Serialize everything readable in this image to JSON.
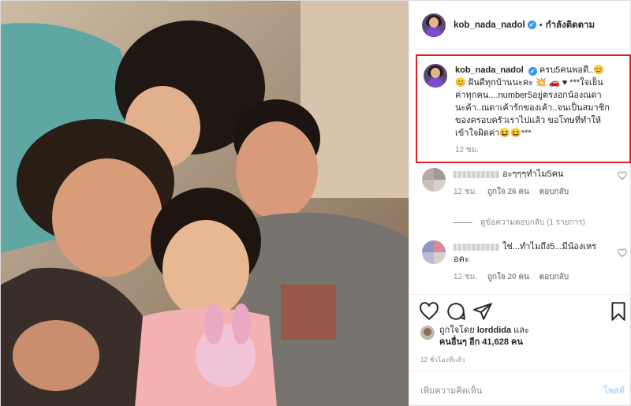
{
  "post": {
    "username": "kob_nada_nadol",
    "verified_mark": "✔",
    "separator": "•",
    "follow_status": "กำลังติดตาม"
  },
  "caption": {
    "username": "kob_nada_nadol",
    "line1": "ครบ5คนพอดี..😊",
    "line2": "😊 ฝันดีทุกบ้านนะคะ 💥 🚗 ♥ ***ใจเย็น",
    "line3": "ค่าทุกคน....number5อยู่ตรงอกน้องณดา",
    "line4": "นะค้า..ณดาเค้ารักของเค้า..จนเป็นสมาชิก",
    "line5": "ของครอบครัวเราไปแล้ว ขอโทษที่ทำให้",
    "line6": "เข้าใจผิดค่า😆😆***",
    "time": "12 ชม.",
    "highlight_color": "#e11f25"
  },
  "comments": [
    {
      "text": "อะๆๆๆทำไม5คน",
      "time": "12 ชม.",
      "likes": "ถูกใจ 26 คน",
      "reply": "ตอบกลับ"
    },
    {
      "text_line1": "ใช่...ทำไมถึง5...มีน้องเหร",
      "text_line2": "อคะ",
      "time": "12 ชม.",
      "likes": "ถูกใจ 20 คน",
      "reply": "ตอบกลับ"
    }
  ],
  "view_replies": "ดูข้อความตอบกลับ (1 รายการ)",
  "liked_by": {
    "prefix": "ถูกใจโดย",
    "user": "lorddida",
    "and": "และ",
    "others": "คนอื่นๆ อีก 41,628 คน"
  },
  "time_ago": "12 ชั่วโมงที่แล้ว",
  "add_comment": {
    "placeholder": "เพิ่มความคิดเห็น",
    "post_label": "โพสต์"
  },
  "icons": [
    "heart-icon",
    "comment-icon",
    "share-icon",
    "bookmark-icon"
  ],
  "colors": {
    "verified": "#3897f0",
    "muted": "#8e8e8e",
    "post_disabled": "#b3dbff"
  }
}
